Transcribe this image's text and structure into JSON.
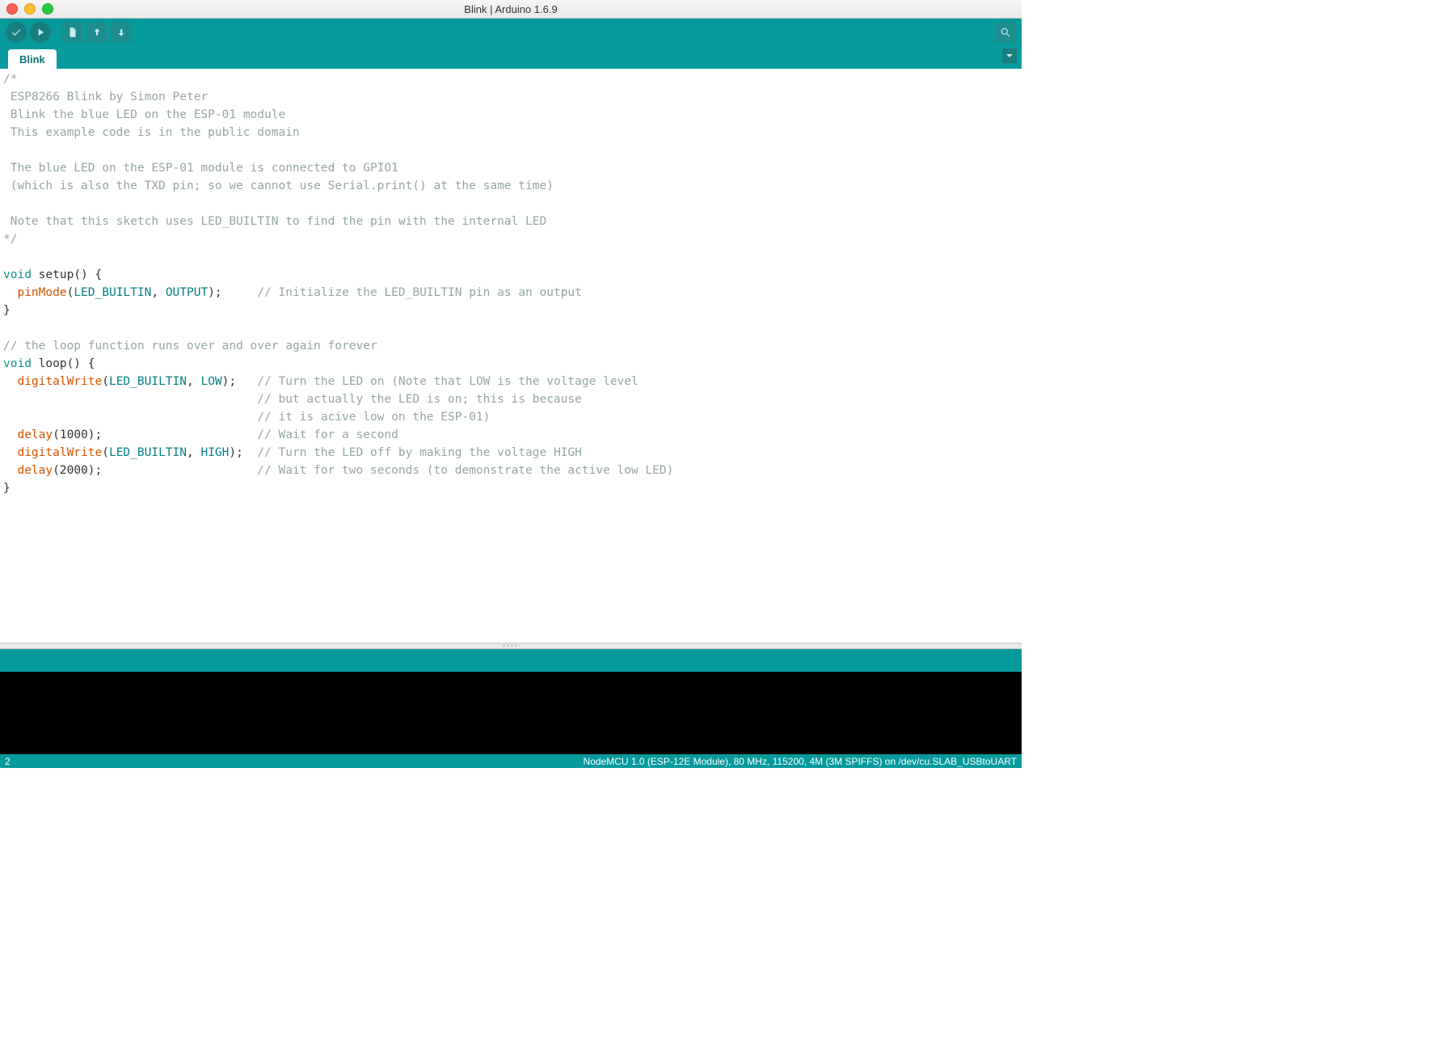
{
  "window": {
    "title": "Blink | Arduino 1.6.9"
  },
  "toolbar": {
    "verify": "Verify",
    "upload": "Upload",
    "new": "New",
    "open": "Open",
    "save": "Save",
    "serial": "Serial Monitor"
  },
  "tab": {
    "label": "Blink"
  },
  "code": {
    "c01": "/*",
    "c02": " ESP8266 Blink by Simon Peter",
    "c03": " Blink the blue LED on the ESP-01 module",
    "c04": " This example code is in the public domain",
    "c05": "",
    "c06": " The blue LED on the ESP-01 module is connected to GPIO1",
    "c07": " (which is also the TXD pin; so we cannot use Serial.print() at the same time)",
    "c08": "",
    "c09": " Note that this sketch uses LED_BUILTIN to find the pin with the internal LED",
    "c10": "*/",
    "kw_void1": "void",
    "txt_setup": " setup() {",
    "fn_pinmode": "pinMode",
    "cn_led1": "LED_BUILTIN",
    "cn_output": "OUTPUT",
    "cmt_init": "// Initialize the LED_BUILTIN pin as an output",
    "brace_close1": "}",
    "cmt_loop": "// the loop function runs over and over again forever",
    "kw_void2": "void",
    "txt_loop": " loop() {",
    "fn_dw1": "digitalWrite",
    "cn_led2": "LED_BUILTIN",
    "cn_low": "LOW",
    "cmt_on1": "// Turn the LED on (Note that LOW is the voltage level",
    "cmt_on2": "// but actually the LED is on; this is because",
    "cmt_on3": "// it is acive low on the ESP-01)",
    "fn_delay1": "delay",
    "num_1000": "1000",
    "cmt_wait1": "// Wait for a second",
    "fn_dw2": "digitalWrite",
    "cn_led3": "LED_BUILTIN",
    "cn_high": "HIGH",
    "cmt_off": "// Turn the LED off by making the voltage HIGH",
    "fn_delay2": "delay",
    "num_2000": "2000",
    "cmt_wait2": "// Wait for two seconds (to demonstrate the active low LED)",
    "brace_close2": "}"
  },
  "footer": {
    "left": "2",
    "right": "NodeMCU 1.0 (ESP-12E Module), 80 MHz, 115200, 4M (3M SPIFFS) on /dev/cu.SLAB_USBtoUART"
  }
}
